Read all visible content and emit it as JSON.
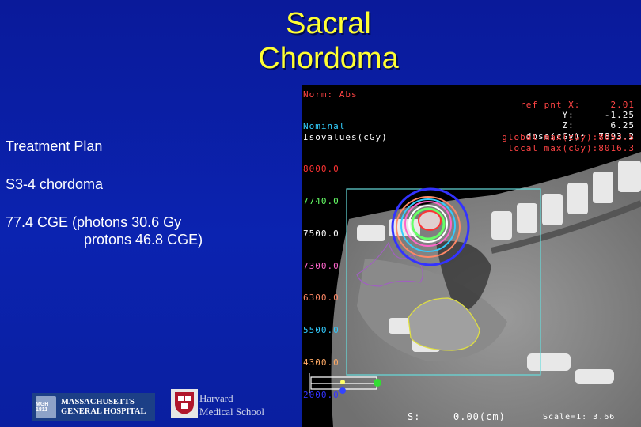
{
  "title": {
    "line1": "Sacral",
    "line2": "Chordoma"
  },
  "left": {
    "heading": "Treatment Plan",
    "diagnosis": "S3-4 chordoma",
    "dose_line1": "77.4 CGE (photons 30.6 Gy",
    "dose_line2": "protons  46.8 CGE)"
  },
  "ct": {
    "norm": "Norm: Abs",
    "ref_x_label": "ref pnt X:",
    "ref_x": "2.01",
    "ref_y_label": "Y:",
    "ref_y": "-1.25",
    "ref_z_label": "Z:",
    "ref_z": "6.25",
    "dose_label": "dose(cGy):",
    "dose": "7893.2",
    "global_max": "global max(cGy):8053.5",
    "local_max": "local max(cGy):8016.3",
    "nominal": "Nominal",
    "isovalues_label": "Isovalues(cGy)",
    "isovalues": [
      {
        "value": "8000.0",
        "color": "#ff3333"
      },
      {
        "value": "7740.0",
        "color": "#66ff66"
      },
      {
        "value": "7500.0",
        "color": "#ffffff"
      },
      {
        "value": "7300.0",
        "color": "#ff66cc"
      },
      {
        "value": "6300.0",
        "color": "#ff8866"
      },
      {
        "value": "5500.0",
        "color": "#33ccff"
      },
      {
        "value": "4300.0",
        "color": "#ffaa66"
      },
      {
        "value": "2000.0",
        "color": "#3333ff"
      }
    ],
    "s_label": "S:",
    "s_value": "0.00(cm)",
    "scale": "Scale=1: 3.66"
  },
  "logos": {
    "mgh_shield": "MGH 1811",
    "mgh_line1": "MASSACHUSETTS",
    "mgh_line2": "GENERAL HOSPITAL",
    "hms_line1": "Harvard",
    "hms_line2": "Medical School"
  }
}
